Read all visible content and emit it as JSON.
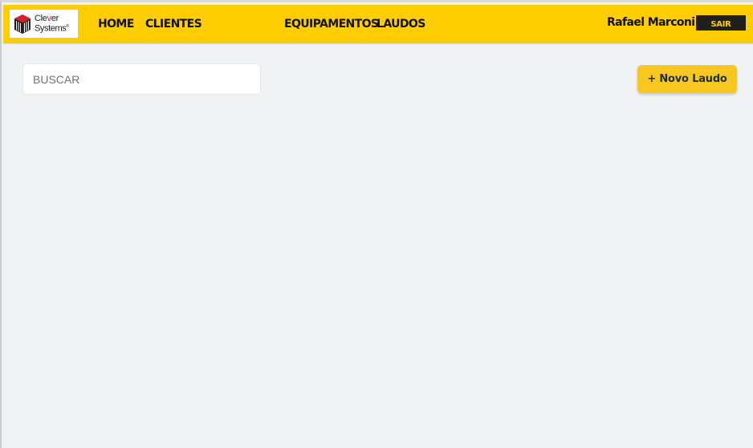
{
  "brand": {
    "logo_line1_a": "Cle",
    "logo_line1_accent": "v",
    "logo_line1_b": "er",
    "logo_line2": "Systems",
    "logo_mark": "®",
    "accent_color": "#ffcd00"
  },
  "nav": {
    "items": [
      {
        "label": "HOME"
      },
      {
        "label": "CLIENTES"
      },
      {
        "label": "EQUIPAMENTOS"
      },
      {
        "label": "LAUDOS"
      }
    ]
  },
  "user": {
    "name": "Rafael Marconi",
    "logout_label": "SAIR"
  },
  "search": {
    "placeholder": "BUSCAR",
    "value": ""
  },
  "actions": {
    "new_label": "+ Novo Laudo"
  }
}
